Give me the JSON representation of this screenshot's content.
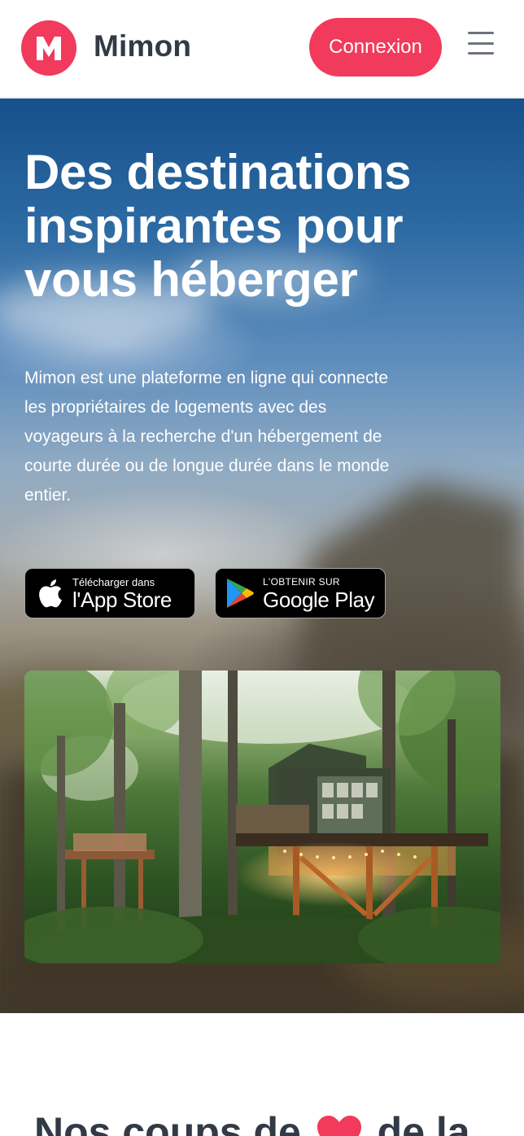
{
  "header": {
    "logo_letter": "M",
    "brand": "Mimon",
    "connexion_label": "Connexion",
    "menu_icon": "hamburger-menu-icon",
    "accent_color": "#f23a5c"
  },
  "hero": {
    "title": "Des destinations inspirantes pour vous héberger",
    "description": "Mimon est une plateforme en ligne qui connecte les propriétaires de logements avec des voyageurs à la recherche d'un hébergement de courte durée ou de longue durée dans le monde entier.",
    "app_store": {
      "small": "Télécharger dans",
      "big": "l'App Store",
      "icon": "apple-icon"
    },
    "google_play": {
      "small": "L'OBTENIR SUR",
      "big": "Google Play",
      "icon": "google-play-icon"
    },
    "photo": "treehouse-forest-photo"
  },
  "section": {
    "title_start": "Nos coups de",
    "title_icon": "heart-icon",
    "title_end": "de la"
  }
}
